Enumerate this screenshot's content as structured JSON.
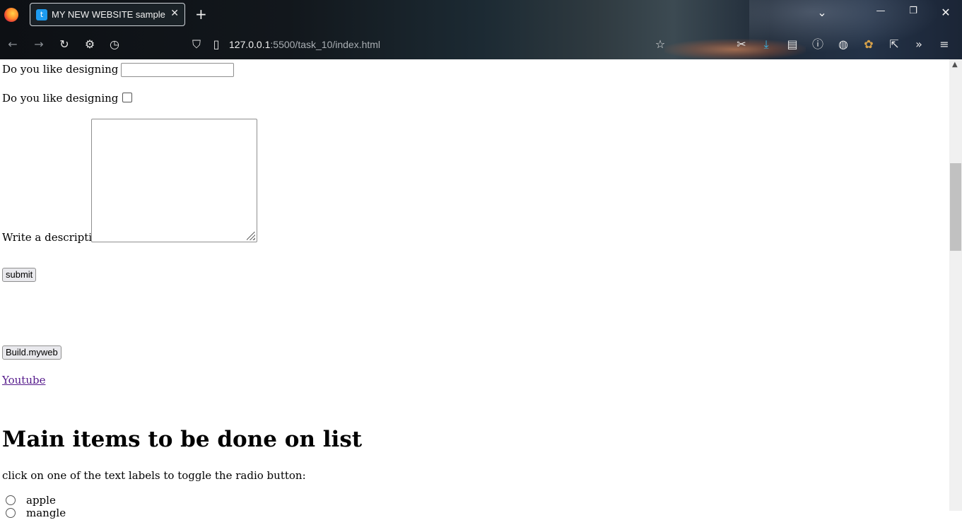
{
  "browser": {
    "tab_title": "MY NEW WEBSITE sample",
    "tab_close": "✕",
    "new_tab": "+",
    "url_host": "127.0.0.1",
    "url_rest": ":5500/task_10/index.html",
    "window_controls": {
      "list_tabs": "⌄",
      "minimize": "—",
      "restore": "❐",
      "close": "✕"
    },
    "icons": [
      "back-icon",
      "forward-icon",
      "reload-icon",
      "settings-icon",
      "history-icon",
      "shield-icon",
      "page-icon",
      "star-icon",
      "extensions-icon",
      "downloads-icon",
      "sidebar-icon",
      "info-icon",
      "cookie-icon",
      "addon-icon",
      "share-icon",
      "overflow-icon",
      "menu-icon"
    ]
  },
  "form": {
    "q1_label": "Do you like designing",
    "q1_value": "",
    "q2_label": "Do you like designing",
    "q2_checked": false,
    "desc_label": "Write a description",
    "desc_value": "",
    "submit_label": "submit",
    "build_label": "Build.myweb",
    "youtube_link": "Youtube"
  },
  "section": {
    "heading": "Main items to be done on list",
    "help_text": "click on one of the text labels to toggle the radio button:",
    "radios": [
      {
        "label": "apple",
        "checked": false
      },
      {
        "label": "mangle",
        "checked": false
      }
    ]
  }
}
